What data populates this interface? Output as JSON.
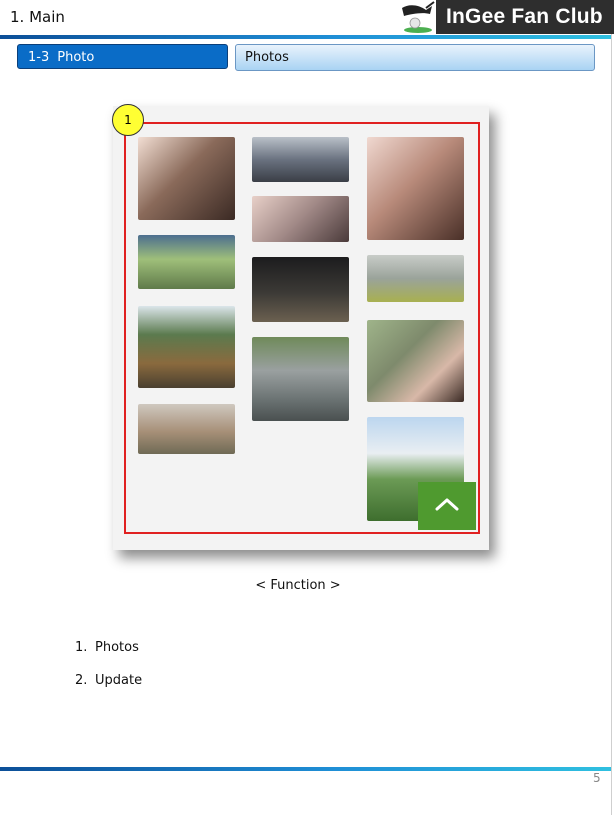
{
  "header": {
    "title": "1. Main",
    "logo_text": "InGee Fan Club"
  },
  "section_tabs": {
    "left_number": "1-3",
    "left_label": "Photo",
    "right_label": "Photos"
  },
  "mockup": {
    "marker_label": "1",
    "photos": [
      {
        "name": "photo-group-selfie-1",
        "color": "#8a6a5a"
      },
      {
        "name": "photo-train-group",
        "color": "#6a7280"
      },
      {
        "name": "photo-three-friends",
        "color": "#b88a7a"
      },
      {
        "name": "photo-selfie-pair",
        "color": "#a08886"
      },
      {
        "name": "photo-green-shirt",
        "color": "#7fa06a"
      },
      {
        "name": "photo-night-pose",
        "color": "#3c3a36"
      },
      {
        "name": "photo-station-pose",
        "color": "#9aa39a"
      },
      {
        "name": "photo-bench-mountain",
        "color": "#6f8a5a"
      },
      {
        "name": "photo-hill-selfie",
        "color": "#7e8a6c"
      },
      {
        "name": "photo-stairs-star",
        "color": "#7d8584"
      },
      {
        "name": "photo-kitchen",
        "color": "#a79078"
      },
      {
        "name": "photo-golf-field",
        "color": "#6b9a55"
      }
    ],
    "scroll_top_icon": "chevron-up-icon"
  },
  "caption": "< Function >",
  "function_list": [
    {
      "number": "1.",
      "label": "Photos"
    },
    {
      "number": "2.",
      "label": "Update"
    }
  ],
  "page_number": "5",
  "colors": {
    "tab_active": "#0a6cc7",
    "frame_red": "#e02020",
    "marker_yellow": "#ffff33",
    "button_green": "#4f9a2f"
  }
}
